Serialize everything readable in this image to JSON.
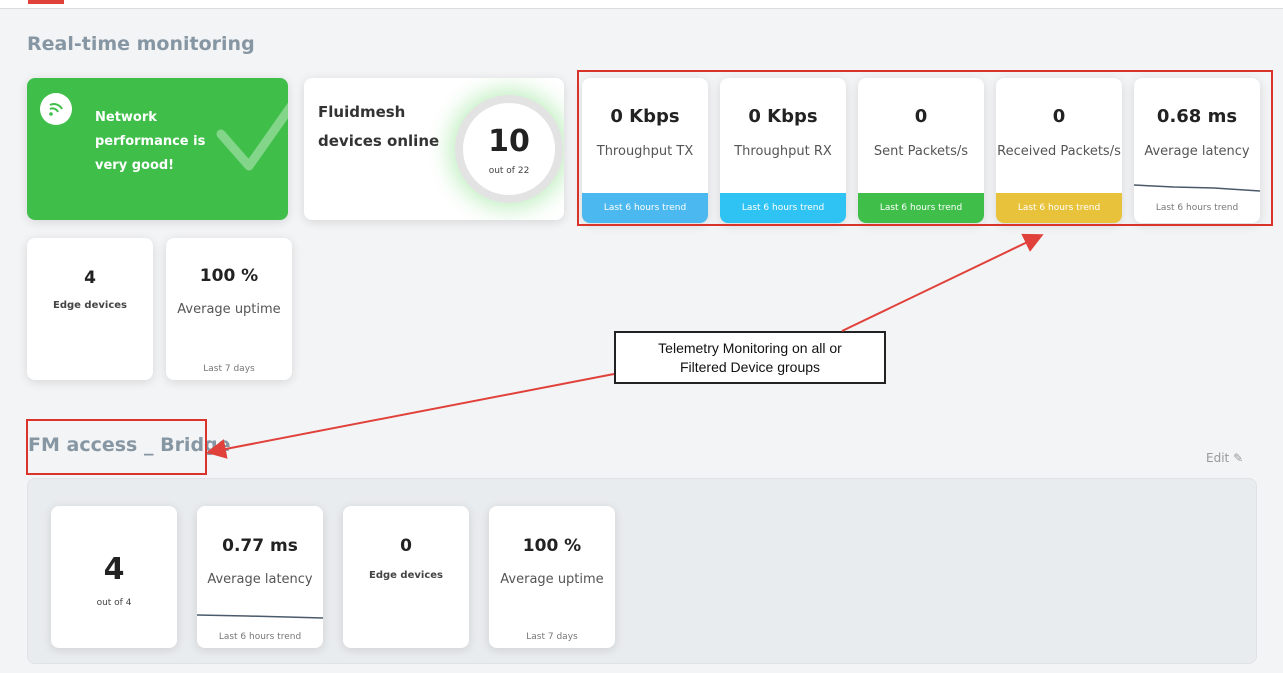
{
  "sections": {
    "realtime_title": "Real-time monitoring",
    "group_title": "FM access _ Bridge",
    "edit_label": "Edit"
  },
  "network_status": {
    "message": "Network performance is very good!",
    "icon": "wifi-icon",
    "color": "#3fbf4a"
  },
  "devices_online": {
    "label": "Fluidmesh devices online",
    "count": "10",
    "subtext": "out of 22",
    "fraction": 0.4545
  },
  "telemetry": [
    {
      "value": "0 Kbps",
      "label": "Throughput TX",
      "trend": "Last 6 hours trend",
      "color": "#4bb8ef"
    },
    {
      "value": "0 Kbps",
      "label": "Throughput RX",
      "trend": "Last 6 hours trend",
      "color": "#2ec3f3"
    },
    {
      "value": "0",
      "label": "Sent Packets/s",
      "trend": "Last 6 hours trend",
      "color": "#3fbf4a"
    },
    {
      "value": "0",
      "label": "Received Packets/s",
      "trend": "Last 6 hours trend",
      "color": "#e8c23b"
    },
    {
      "value": "0.68 ms",
      "label": "Average latency",
      "trend": "Last 6 hours trend",
      "color": "#ffffff"
    }
  ],
  "edge_devices": {
    "value": "4",
    "label": "Edge devices"
  },
  "average_uptime": {
    "value": "100 %",
    "label": "Average uptime",
    "footer": "Last 7 days"
  },
  "callout": {
    "line1": "Telemetry Monitoring on all or",
    "line2": "Filtered Device groups"
  },
  "group": {
    "count": {
      "value": "4",
      "label": "out of 4"
    },
    "latency": {
      "value": "0.77 ms",
      "label": "Average latency",
      "footer": "Last 6 hours trend"
    },
    "edge": {
      "value": "0",
      "label": "Edge devices"
    },
    "uptime": {
      "value": "100 %",
      "label": "Average uptime",
      "footer": "Last 7 days"
    }
  },
  "colors": {
    "accent_red": "#d9332c",
    "title_gray": "#8696a3"
  }
}
